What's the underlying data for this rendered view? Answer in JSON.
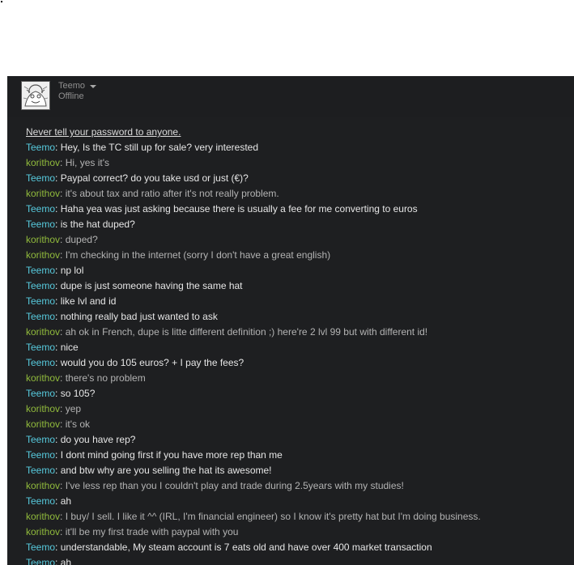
{
  "header": {
    "user_name": "Teemo",
    "status": "Offline"
  },
  "notice": "Never tell your password to anyone.",
  "messages": [
    {
      "sender": "Teemo",
      "role": "teemo",
      "text": "Hey, Is the TC still up for sale? very interested"
    },
    {
      "sender": "korithov",
      "role": "korithov",
      "text": "Hi, yes it's"
    },
    {
      "sender": "Teemo",
      "role": "teemo",
      "text": "Paypal correct? do you take usd or just (€)?"
    },
    {
      "sender": "korithov",
      "role": "korithov",
      "text": "it's about tax and ratio after it's not really problem."
    },
    {
      "sender": "Teemo",
      "role": "teemo",
      "text": "Haha yea was just asking because there is usually a fee for me converting to euros"
    },
    {
      "sender": "Teemo",
      "role": "teemo",
      "text": "is the hat duped?"
    },
    {
      "sender": "korithov",
      "role": "korithov",
      "text": "duped?"
    },
    {
      "sender": "korithov",
      "role": "korithov",
      "text": "I'm checking in the internet (sorry I don't have a great english)"
    },
    {
      "sender": "Teemo",
      "role": "teemo",
      "text": "np lol"
    },
    {
      "sender": "Teemo",
      "role": "teemo",
      "text": "dupe is just someone having the same hat"
    },
    {
      "sender": "Teemo",
      "role": "teemo",
      "text": "like lvl and id"
    },
    {
      "sender": "Teemo",
      "role": "teemo",
      "text": "nothing really bad just wanted to ask"
    },
    {
      "sender": "korithov",
      "role": "korithov",
      "text": "ah ok in French, dupe is litte different definition ;) here're 2 lvl 99 but with different id!"
    },
    {
      "sender": "Teemo",
      "role": "teemo",
      "text": "nice"
    },
    {
      "sender": "Teemo",
      "role": "teemo",
      "text": "would you do 105 euros? + I pay the fees?"
    },
    {
      "sender": "korithov",
      "role": "korithov",
      "text": "there's no problem"
    },
    {
      "sender": "Teemo",
      "role": "teemo",
      "text": "so 105?"
    },
    {
      "sender": "korithov",
      "role": "korithov",
      "text": "yep"
    },
    {
      "sender": "korithov",
      "role": "korithov",
      "text": "it's ok"
    },
    {
      "sender": "Teemo",
      "role": "teemo",
      "text": "do you have rep?"
    },
    {
      "sender": "Teemo",
      "role": "teemo",
      "text": "I dont mind going first if you have more rep than me"
    },
    {
      "sender": "Teemo",
      "role": "teemo",
      "text": "and btw why are you selling the hat its awesome!"
    },
    {
      "sender": "korithov",
      "role": "korithov",
      "text": "I've less rep than you I couldn't play and trade during 2.5years with my studies!"
    },
    {
      "sender": "Teemo",
      "role": "teemo",
      "text": "ah"
    },
    {
      "sender": "korithov",
      "role": "korithov",
      "text": "I buy/ I sell. I like it ^^ (IRL, I'm financial engineer) so I know it's pretty hat but I'm doing business."
    },
    {
      "sender": "korithov",
      "role": "korithov",
      "text": "it'll be my first trade with paypal with you"
    },
    {
      "sender": "Teemo",
      "role": "teemo",
      "text": "understandable, My steam account is 7 eats old and have over 400 market transaction"
    },
    {
      "sender": "Teemo",
      "role": "teemo",
      "text": "ah"
    }
  ]
}
